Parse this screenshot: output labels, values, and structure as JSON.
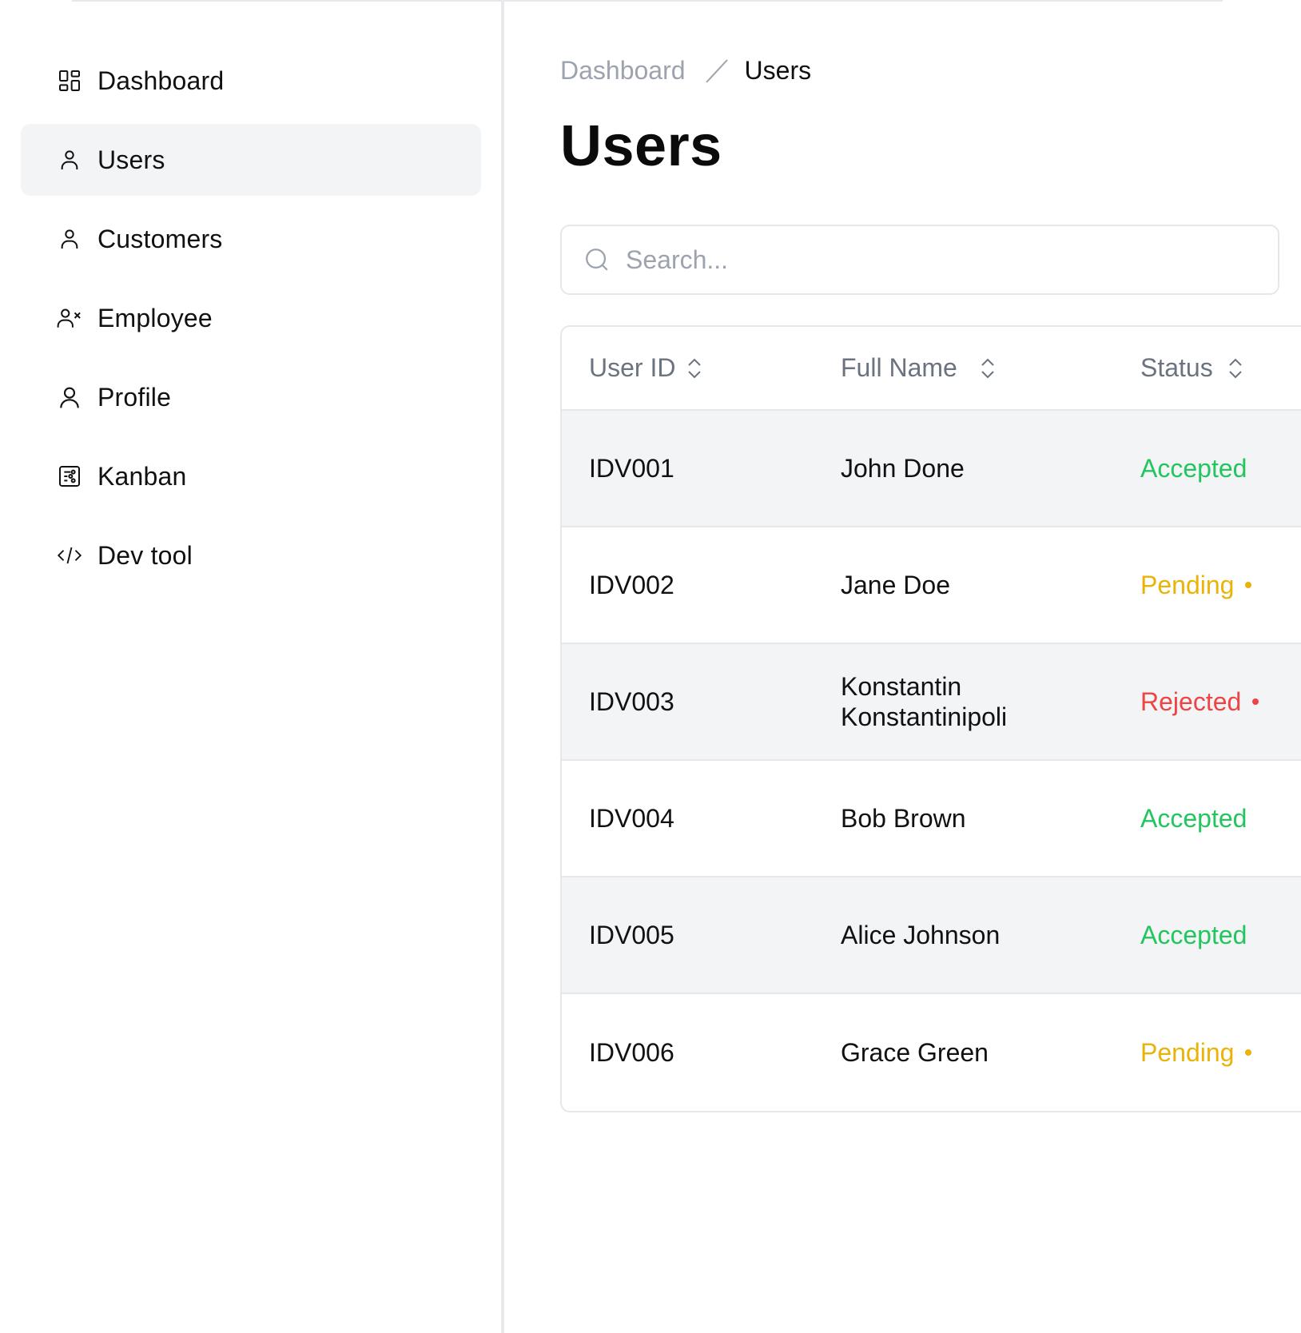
{
  "sidebar": {
    "items": [
      {
        "label": "Dashboard",
        "icon": "dashboard-icon"
      },
      {
        "label": "Users",
        "icon": "user-icon",
        "active": true
      },
      {
        "label": "Customers",
        "icon": "user-icon"
      },
      {
        "label": "Employee",
        "icon": "user-x-icon"
      },
      {
        "label": "Profile",
        "icon": "profile-icon"
      },
      {
        "label": "Kanban",
        "icon": "kanban-icon"
      },
      {
        "label": "Dev tool",
        "icon": "code-icon"
      }
    ]
  },
  "breadcrumb": {
    "parent": "Dashboard",
    "current": "Users"
  },
  "page": {
    "title": "Users"
  },
  "search": {
    "placeholder": "Search..."
  },
  "table": {
    "columns": [
      "User ID",
      "Full Name",
      "Status"
    ],
    "rows": [
      {
        "id": "IDV001",
        "name": "John Done",
        "status": "Accepted"
      },
      {
        "id": "IDV002",
        "name": "Jane Doe",
        "status": "Pending"
      },
      {
        "id": "IDV003",
        "name": "Konstantin Konstantinipoli",
        "status": "Rejected"
      },
      {
        "id": "IDV004",
        "name": "Bob Brown",
        "status": "Accepted"
      },
      {
        "id": "IDV005",
        "name": "Alice Johnson",
        "status": "Accepted"
      },
      {
        "id": "IDV006",
        "name": "Grace Green",
        "status": "Pending"
      }
    ]
  },
  "colors": {
    "accepted": "#22c55e",
    "pending": "#eab308",
    "rejected": "#ef4444",
    "muted": "#9ca3af"
  }
}
